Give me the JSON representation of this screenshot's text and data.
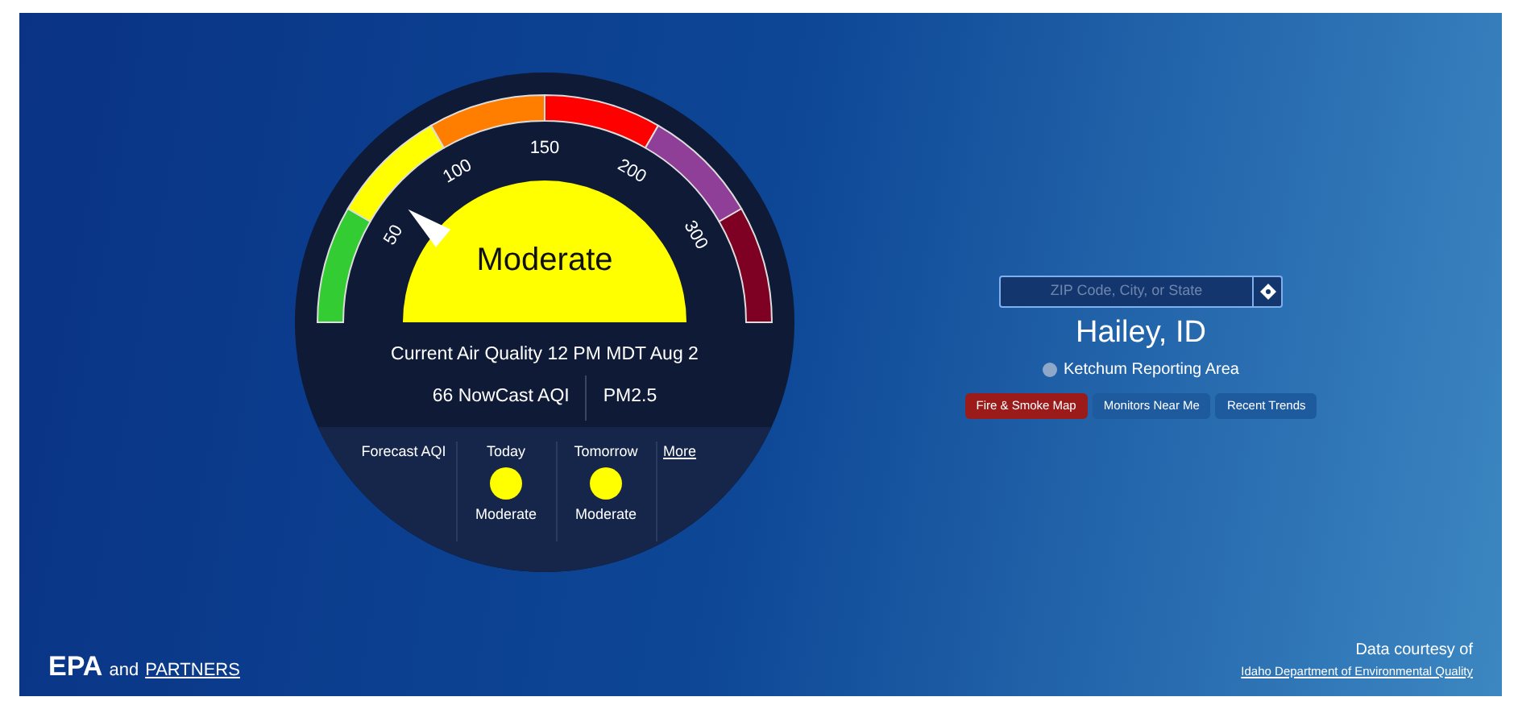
{
  "gauge": {
    "segments": [
      {
        "color": "#33cc33"
      },
      {
        "color": "#ffff00"
      },
      {
        "color": "#ff7e00"
      },
      {
        "color": "#ff0000"
      },
      {
        "color": "#8f3f97"
      },
      {
        "color": "#7e0023"
      }
    ],
    "ticks": [
      "50",
      "100",
      "150",
      "200",
      "300"
    ],
    "level": 0.22,
    "category": "Moderate",
    "color": "#ffff00"
  },
  "current": {
    "title": "Current Air Quality 12 PM MDT Aug 2",
    "aqi": "66 NowCast AQI",
    "pollutant": "PM2.5"
  },
  "forecast": {
    "label": "Forecast AQI",
    "days": [
      {
        "day": "Today",
        "color": "#ffff00",
        "category": "Moderate"
      },
      {
        "day": "Tomorrow",
        "color": "#ffff00",
        "category": "Moderate"
      }
    ],
    "more_link": "More"
  },
  "search": {
    "placeholder": "ZIP Code, City, or State"
  },
  "location": {
    "city": "Hailey, ID",
    "reporting_area": "Ketchum Reporting Area"
  },
  "buttons": [
    {
      "label": "Fire & Smoke Map",
      "selected": true
    },
    {
      "label": "Monitors Near Me",
      "selected": false
    },
    {
      "label": "Recent Trends",
      "selected": false
    }
  ],
  "footer": {
    "logo": "EPA",
    "and": "and",
    "partners_link": "PARTNERS",
    "courtesy": "Data courtesy of",
    "source_link": "Idaho Department of Environmental Quality"
  }
}
